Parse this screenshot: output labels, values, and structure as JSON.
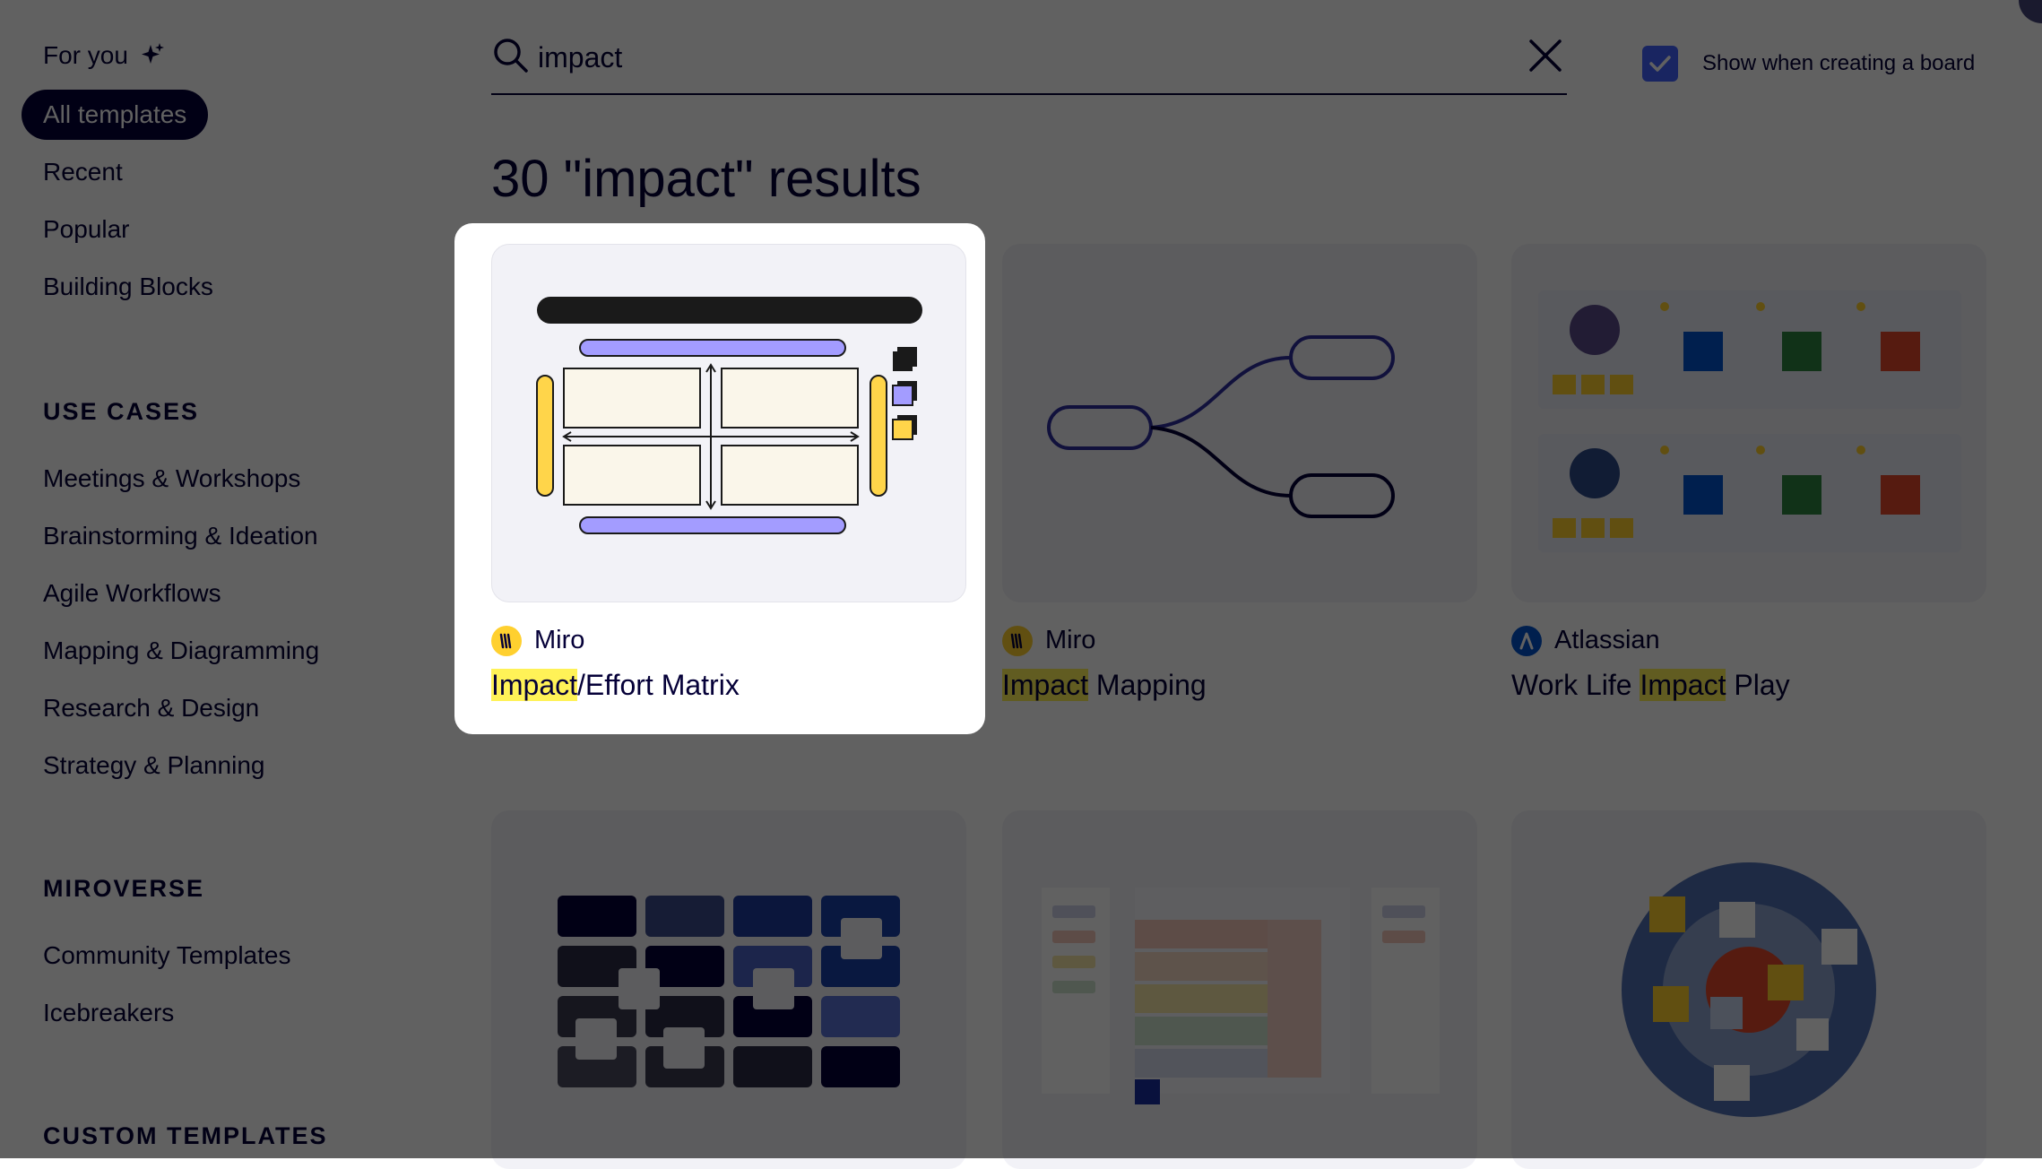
{
  "search": {
    "value": "impact",
    "placeholder": ""
  },
  "settings": {
    "show_when_creating_label": "Show when creating a board",
    "show_when_creating_checked": true
  },
  "sidebar": {
    "for_you": "For you",
    "items": [
      "All templates",
      "Recent",
      "Popular",
      "Building Blocks"
    ],
    "use_cases_title": "USE CASES",
    "use_cases": [
      "Meetings & Workshops",
      "Brainstorming & Ideation",
      "Agile Workflows",
      "Mapping & Diagramming",
      "Research & Design",
      "Strategy & Planning"
    ],
    "miroverse_title": "MIROVERSE",
    "miroverse": [
      "Community Templates",
      "Icebreakers"
    ],
    "custom_title": "CUSTOM TEMPLATES"
  },
  "results": {
    "title": "30 \"impact\" results",
    "cards": [
      {
        "author": "Miro",
        "title_pre": "",
        "title_hl": "Impact",
        "title_post": "/Effort Matrix"
      },
      {
        "author": "Miro",
        "title_pre": "",
        "title_hl": "Impact",
        "title_post": " Mapping"
      },
      {
        "author": "Atlassian",
        "title_pre": "Work Life ",
        "title_hl": "Impact",
        "title_post": " Play"
      }
    ]
  },
  "colors": {
    "ink": "#050038",
    "miro_yellow": "#ffd02f",
    "atlassian_blue": "#0052cc",
    "highlight": "#fff257",
    "accent_blue": "#4262ff",
    "matrix_purple": "#a39cff"
  }
}
